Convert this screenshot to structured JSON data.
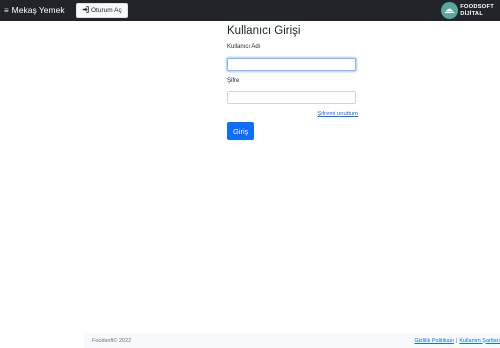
{
  "navbar": {
    "menu_icon": "hamburger-icon",
    "brand": "Mekaş Yemek",
    "login_button": "Oturum Aç",
    "login_icon": "sign-in-icon",
    "logo_line1": "FOODSOFT",
    "logo_line2": "DİJİTAL"
  },
  "login": {
    "title": "Kullanıcı Girişi",
    "username_label": "Kullanıcı Adı",
    "username_value": "",
    "password_label": "Şifre",
    "password_value": "",
    "forgot_link": "Şifremi unuttum",
    "submit": "Giriş"
  },
  "footer": {
    "copyright": "Foodsoft© 2022",
    "privacy_link": "Gizlilik Politikası",
    "terms_link": "Kullanım Şartları",
    "separator": "|"
  },
  "colors": {
    "navbar_bg": "#212529",
    "primary": "#0d6efd",
    "logo_accent": "#5aa6a0"
  }
}
